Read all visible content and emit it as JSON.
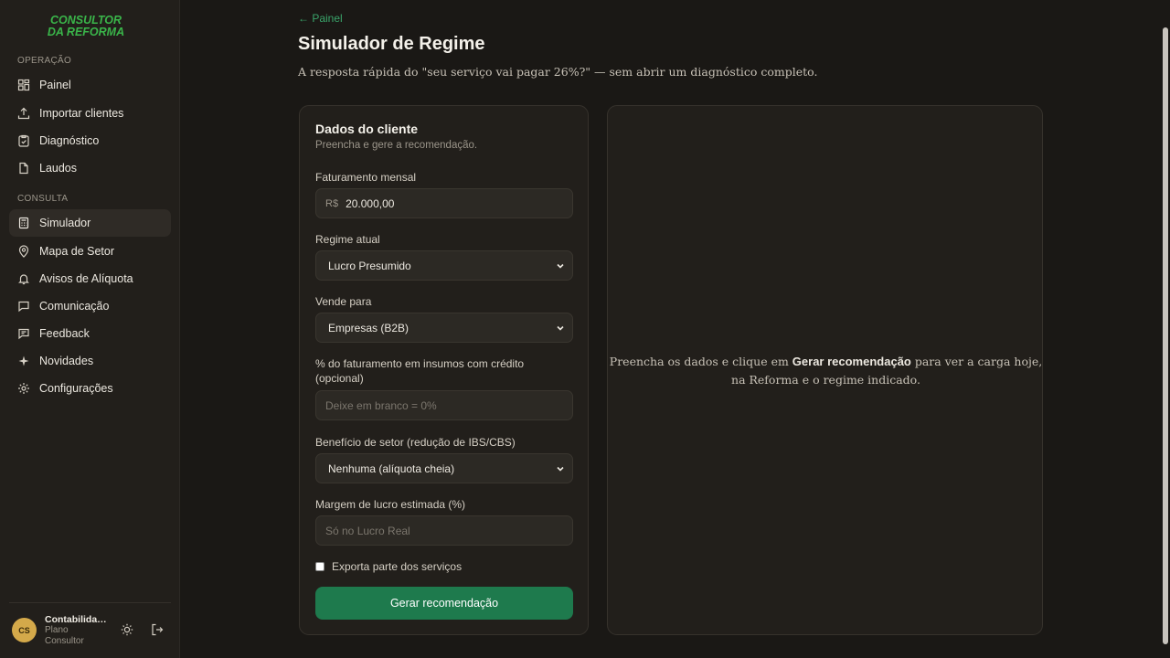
{
  "brand": {
    "line1": "CONSULTOR",
    "line2": "DA REFORMA",
    "color": "#3ab54a"
  },
  "sidebar": {
    "section_operacao": "OPERAÇÃO",
    "section_consulta": "CONSULTA",
    "items": [
      {
        "label": "Painel",
        "icon": "grid-icon"
      },
      {
        "label": "Importar clientes",
        "icon": "upload-icon"
      },
      {
        "label": "Diagnóstico",
        "icon": "clipboard-check-icon"
      },
      {
        "label": "Laudos",
        "icon": "file-icon"
      },
      {
        "label": "Simulador",
        "icon": "calculator-icon",
        "active": true
      },
      {
        "label": "Mapa de Setor",
        "icon": "map-pin-icon"
      },
      {
        "label": "Avisos de Alíquota",
        "icon": "bell-icon"
      },
      {
        "label": "Comunicação",
        "icon": "message-icon"
      },
      {
        "label": "Feedback",
        "icon": "feedback-icon"
      },
      {
        "label": "Novidades",
        "icon": "sparkle-icon"
      },
      {
        "label": "Configurações",
        "icon": "gear-icon"
      }
    ],
    "user": {
      "initials": "CS",
      "name": "Contabilidade Silva",
      "plan": "Plano Consultor"
    }
  },
  "header": {
    "back": "← Painel",
    "title": "Simulador de Regime",
    "subtitle": "A resposta rápida do \"seu serviço vai pagar 26%?\" — sem abrir um diagnóstico completo."
  },
  "form": {
    "title": "Dados do cliente",
    "subtitle": "Preencha e gere a recomendação.",
    "faturamento_label": "Faturamento mensal",
    "faturamento_prefix": "R$",
    "faturamento_value": "20.000,00",
    "regime_label": "Regime atual",
    "regime_value": "Lucro Presumido",
    "vende_label": "Vende para",
    "vende_value": "Empresas (B2B)",
    "insumos_label": "% do faturamento em insumos com crédito (opcional)",
    "insumos_placeholder": "Deixe em branco = 0%",
    "beneficio_label": "Benefício de setor (redução de IBS/CBS)",
    "beneficio_value": "Nenhuma (alíquota cheia)",
    "margem_label": "Margem de lucro estimada (%)",
    "margem_placeholder": "Só no Lucro Real",
    "exporta_label": "Exporta parte dos serviços",
    "submit": "Gerar recomendação"
  },
  "result": {
    "msg_before": "Preencha os dados e clique em ",
    "msg_bold": "Gerar recomendação",
    "msg_after": " para ver a carga hoje, na Reforma e o regime indicado."
  },
  "colors": {
    "accent": "#1e7a4d",
    "link": "#3aa46a",
    "background": "#1a1815",
    "card": "#221f1b"
  }
}
